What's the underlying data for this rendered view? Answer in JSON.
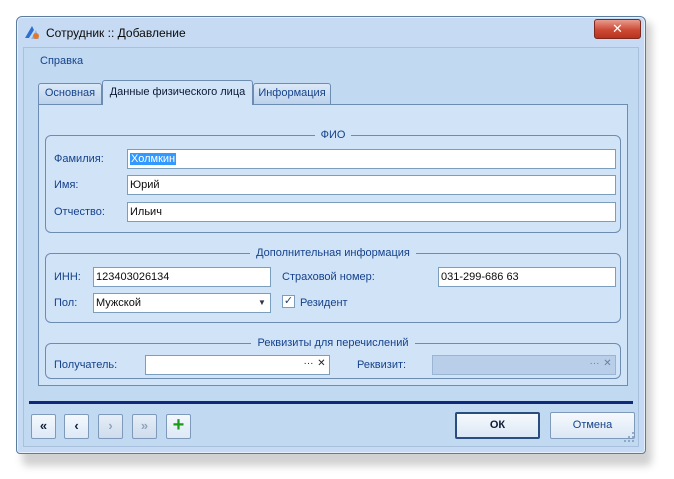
{
  "window": {
    "title": "Сотрудник :: Добавление",
    "close_symbol": "✕"
  },
  "menu": {
    "help": "Справка"
  },
  "tabs": [
    {
      "label": "Основная",
      "active": false
    },
    {
      "label": "Данные физического лица",
      "active": true
    },
    {
      "label": "Информация",
      "active": false
    }
  ],
  "fio": {
    "title": "ФИО",
    "surname_label": "Фамилия:",
    "surname_value": "Холмкин",
    "name_label": "Имя:",
    "name_value": "Юрий",
    "patronymic_label": "Отчество:",
    "patronymic_value": "Ильич"
  },
  "additional": {
    "title": "Дополнительная информация",
    "inn_label": "ИНН:",
    "inn_value": "123403026134",
    "insurance_label": "Страховой номер:",
    "insurance_value": "031-299-686 63",
    "gender_label": "Пол:",
    "gender_value": "Мужской",
    "resident_label": "Резидент",
    "resident_checked": true
  },
  "requisites": {
    "title": "Реквизиты для перечислений",
    "recipient_label": "Получатель:",
    "recipient_value": "",
    "requisite_label": "Реквизит:",
    "requisite_value": "",
    "ellipsis": "···",
    "clear": "✕"
  },
  "nav": {
    "first": "«",
    "prev": "‹",
    "next": "›",
    "last": "»",
    "add": "+"
  },
  "buttons": {
    "ok": "ОК",
    "cancel": "Отмена"
  },
  "colors": {
    "client_bg": "#c2d9f2",
    "accent": "#15428b",
    "divider": "#10287a",
    "close_btn": "#cc4a35",
    "add_green": "#1c9a1c"
  }
}
